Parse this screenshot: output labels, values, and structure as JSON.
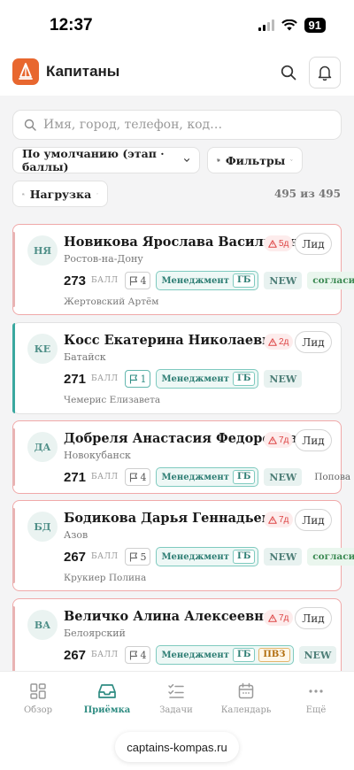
{
  "status_bar": {
    "time": "12:37",
    "battery": "91"
  },
  "header": {
    "title": "Капитаны"
  },
  "search": {
    "placeholder": "Имя, город, телефон, код…"
  },
  "controls": {
    "sort_label": "По умолчанию (этап · баллы)",
    "filters_label": "Фильтры",
    "load_label": "Нагрузка",
    "count": "495 из 495"
  },
  "cards": [
    {
      "initials": "НЯ",
      "name": "Новикова Ярослава Васильевна",
      "city": "Ростов-на-Дону",
      "alert": "5д",
      "stage": "Лид",
      "score": "273",
      "score_label": "БАЛЛ",
      "flags": "4",
      "mgmt": "Менеджмент",
      "gb": "ГБ",
      "new": "NEW",
      "agree": "согласие",
      "manager": "Жертовский Артём"
    },
    {
      "initials": "КЕ",
      "name": "Косс Екатерина Николаевна",
      "city": "Батайск",
      "alert": "2д",
      "stage": "Лид",
      "score": "271",
      "score_label": "БАЛЛ",
      "flags": "1",
      "mgmt": "Менеджмент",
      "gb": "ГБ",
      "new": "NEW",
      "manager": "Чемерис Елизавета"
    },
    {
      "initials": "ДА",
      "name": "Добреля Анастасия Федоровна",
      "city": "Новокубанск",
      "alert": "7д",
      "stage": "Лид",
      "score": "271",
      "score_label": "БАЛЛ",
      "flags": "4",
      "mgmt": "Менеджмент",
      "gb": "ГБ",
      "new": "NEW",
      "manager": "Попова Мария"
    },
    {
      "initials": "БД",
      "name": "Бодикова Дарья Геннадьевна",
      "city": "Азов",
      "alert": "7д",
      "stage": "Лид",
      "score": "267",
      "score_label": "БАЛЛ",
      "flags": "5",
      "mgmt": "Менеджмент",
      "gb": "ГБ",
      "new": "NEW",
      "agree": "согласие",
      "manager": "Крукиер Полина"
    },
    {
      "initials": "ВА",
      "name": "Величко Алина Алексеевна",
      "city": "Белоярский",
      "alert": "7д",
      "stage": "Лид",
      "score": "267",
      "score_label": "БАЛЛ",
      "flags": "4",
      "mgmt": "Менеджмент",
      "gb": "ГБ",
      "pvz": "ПВЗ",
      "new": "NEW"
    }
  ],
  "tabs": [
    {
      "label": "Обзор",
      "icon": "dashboard-icon"
    },
    {
      "label": "Приёмка",
      "icon": "inbox-icon"
    },
    {
      "label": "Задачи",
      "icon": "checklist-icon"
    },
    {
      "label": "Календарь",
      "icon": "calendar-icon"
    },
    {
      "label": "Ещё",
      "icon": "more-icon"
    }
  ],
  "browser": {
    "url": "captains-kompas.ru"
  },
  "colors": {
    "accent": "#2f8c82",
    "logo": "#e8672f",
    "alert": "#dd4444"
  }
}
